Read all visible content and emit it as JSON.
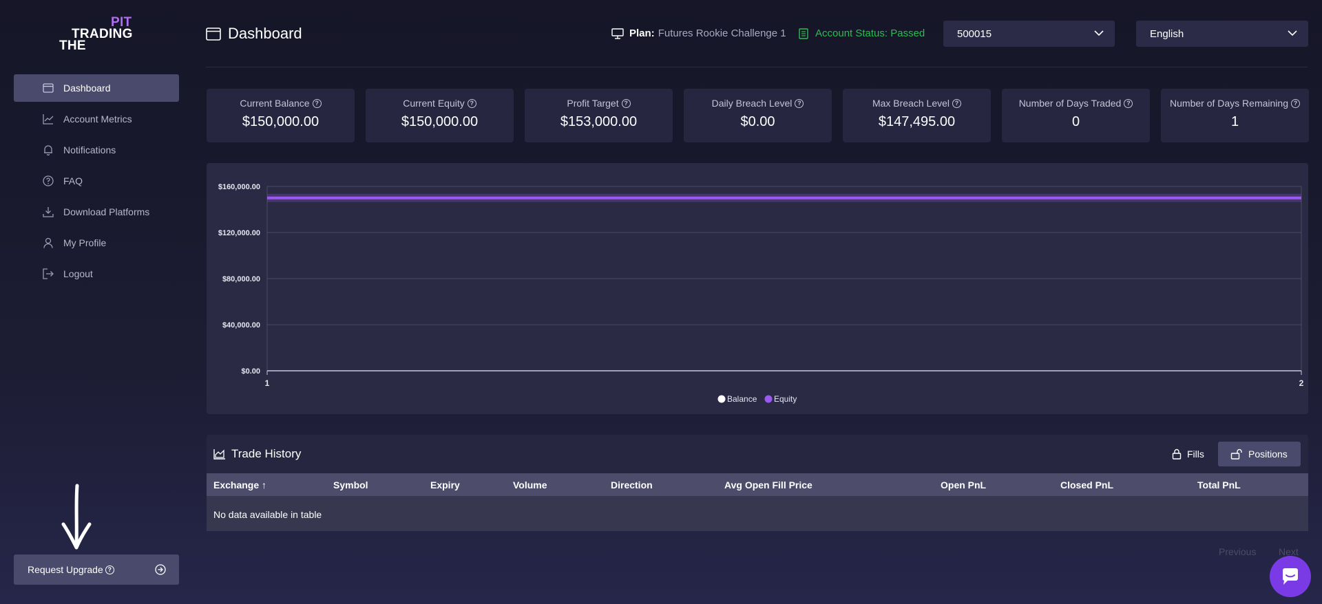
{
  "logo": {
    "line1": "PIT",
    "line2": "TRADING",
    "line3": "THE"
  },
  "sidebar": {
    "items": [
      {
        "label": "Dashboard",
        "icon": "calendar-icon",
        "active": true
      },
      {
        "label": "Account Metrics",
        "icon": "chart-line-icon"
      },
      {
        "label": "Notifications",
        "icon": "bell-icon"
      },
      {
        "label": "FAQ",
        "icon": "question-circle-icon"
      },
      {
        "label": "Download Platforms",
        "icon": "download-icon"
      },
      {
        "label": "My Profile",
        "icon": "user-icon"
      },
      {
        "label": "Logout",
        "icon": "logout-icon"
      }
    ],
    "upgrade_label": "Request Upgrade"
  },
  "header": {
    "title": "Dashboard",
    "plan_label": "Plan:",
    "plan_value": "Futures Rookie Challenge 1",
    "status": "Account Status: Passed",
    "account_select": "500015",
    "language_select": "English"
  },
  "cards": [
    {
      "title": "Current Balance",
      "value": "$150,000.00"
    },
    {
      "title": "Current Equity",
      "value": "$150,000.00"
    },
    {
      "title": "Profit Target",
      "value": "$153,000.00"
    },
    {
      "title": "Daily Breach Level",
      "value": "$0.00"
    },
    {
      "title": "Max Breach Level",
      "value": "$147,495.00"
    },
    {
      "title": "Number of Days Traded",
      "value": "0"
    },
    {
      "title": "Number of Days Remaining",
      "value": "1"
    }
  ],
  "chart_data": {
    "type": "line",
    "x": [
      1,
      2
    ],
    "series": [
      {
        "name": "Balance",
        "values": [
          150000,
          150000
        ],
        "color": "#ffffff"
      },
      {
        "name": "Equity",
        "values": [
          150000,
          150000
        ],
        "color": "#9b59f0"
      }
    ],
    "ylim": [
      0,
      160000
    ],
    "yticks": [
      "$0.00",
      "$40,000.00",
      "$80,000.00",
      "$120,000.00",
      "$160,000.00"
    ],
    "xticks": [
      "1",
      "2"
    ],
    "legend": "bottom-center",
    "grid": true
  },
  "trade_history": {
    "title": "Trade History",
    "fills_label": "Fills",
    "positions_label": "Positions",
    "columns": [
      "Exchange ↑",
      "Symbol",
      "Expiry",
      "Volume",
      "Direction",
      "Avg Open Fill Price",
      "Open PnL",
      "Closed PnL",
      "Total PnL"
    ],
    "empty_text": "No data available in table"
  },
  "pagination": {
    "previous": "Previous",
    "next": "Next"
  }
}
